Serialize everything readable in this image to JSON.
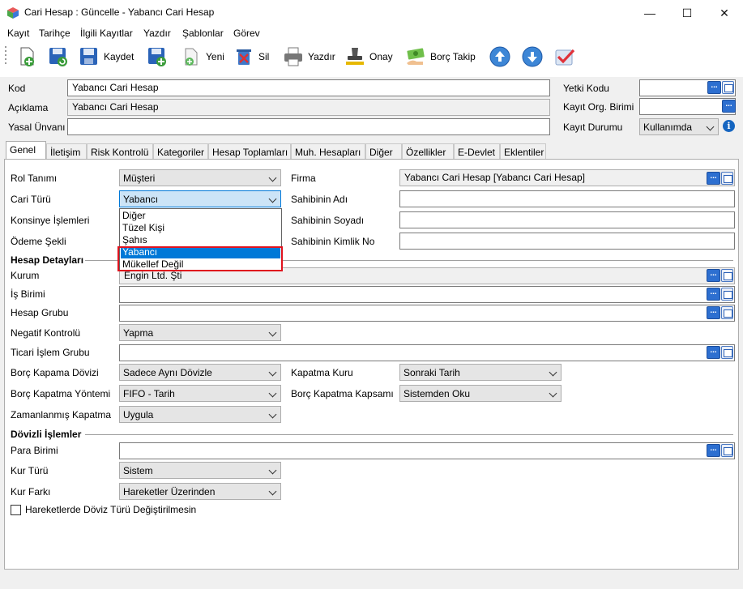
{
  "window": {
    "title": "Cari Hesap : Güncelle - Yabancı Cari Hesap",
    "minimize_glyph": "—",
    "maximize_glyph": "☐",
    "close_glyph": "✕"
  },
  "menu": [
    "Kayıt",
    "Tarihçe",
    "İlgili Kayıtlar",
    "Yazdır",
    "Şablonlar",
    "Görev"
  ],
  "toolbar": {
    "save_label": "Kaydet",
    "new_label": "Yeni",
    "delete_label": "Sil",
    "print_label": "Yazdır",
    "approve_label": "Onay",
    "debt_track_label": "Borç Takip"
  },
  "header": {
    "kod_label": "Kod",
    "kod_value": "Yabancı Cari Hesap",
    "aciklama_label": "Açıklama",
    "aciklama_value": "Yabancı Cari Hesap",
    "yasal_unvan_label": "Yasal Ünvanı",
    "yasal_unvan_value": "",
    "yetki_kodu_label": "Yetki Kodu",
    "kayit_org_label": "Kayıt Org. Birimi",
    "kayit_durumu_label": "Kayıt Durumu",
    "kayit_durumu_value": "Kullanımda"
  },
  "tabs": [
    "Genel",
    "İletişim",
    "Risk Kontrolü",
    "Kategoriler",
    "Hesap Toplamları",
    "Muh. Hesapları",
    "Diğer",
    "Özellikler",
    "E-Devlet",
    "Eklentiler"
  ],
  "general": {
    "rol_tanimi_label": "Rol Tanımı",
    "rol_tanimi_value": "Müşteri",
    "cari_turu_label": "Cari Türü",
    "cari_turu_value": "Yabancı",
    "konsinye_label": "Konsinye İşlemleri",
    "odeme_sekli_label": "Ödeme Şekli",
    "firma_label": "Firma",
    "firma_value": "Yabancı Cari Hesap [Yabancı Cari Hesap]",
    "sahibinin_adi_label": "Sahibinin Adı",
    "sahibinin_soyadi_label": "Sahibinin Soyadı",
    "sahibinin_kimlik_label": "Sahibinin Kimlik No"
  },
  "dropdown": {
    "options": [
      "Diğer",
      "Tüzel Kişi",
      "Şahıs",
      "Yabancı",
      "Mükellef Değil"
    ],
    "selected": "Yabancı"
  },
  "hesap_detaylari": {
    "title": "Hesap Detayları",
    "kurum_label": "Kurum",
    "kurum_value": "Engin Ltd. Şti",
    "is_birimi_label": "İş Birimi",
    "hesap_grubu_label": "Hesap Grubu",
    "negatif_kontrol_label": "Negatif Kontrolü",
    "negatif_kontrol_value": "Yapma",
    "ticari_islem_label": "Ticari İşlem Grubu",
    "borc_kapama_doviz_label": "Borç Kapama Dövizi",
    "borc_kapama_doviz_value": "Sadece Aynı Dövizle",
    "borc_kapatma_yontemi_label": "Borç Kapatma Yöntemi",
    "borc_kapatma_yontemi_value": "FIFO - Tarih",
    "zamanlanmis_label": "Zamanlanmış Kapatma",
    "zamanlanmis_value": "Uygula",
    "kapatma_kuru_label": "Kapatma Kuru",
    "kapatma_kuru_value": "Sonraki Tarih",
    "borc_kapsami_label": "Borç Kapatma Kapsamı",
    "borc_kapsami_value": "Sistemden Oku"
  },
  "dovizli": {
    "title": "Dövizli İşlemler",
    "para_birimi_label": "Para Birimi",
    "kur_turu_label": "Kur Türü",
    "kur_turu_value": "Sistem",
    "kur_farki_label": "Kur Farkı",
    "kur_farki_value": "Hareketler Üzerinden",
    "doviz_degismesin_label": "Hareketlerde Döviz Türü Değiştirilmesin"
  },
  "icons": {
    "dots": "...",
    "info": "i"
  }
}
